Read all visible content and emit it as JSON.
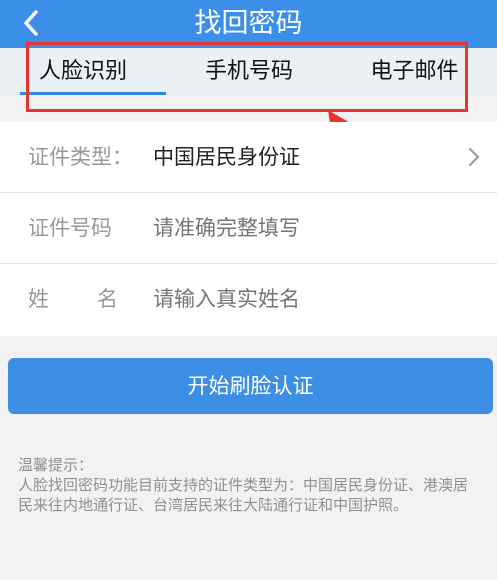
{
  "header": {
    "title": "找回密码",
    "back_icon": "chevron-left-icon",
    "back_glyph": "<",
    "background": "#3c8fe8"
  },
  "tabs": [
    {
      "label": "人脸识别",
      "selected": true
    },
    {
      "label": "手机号码",
      "selected": false
    },
    {
      "label": "电子邮件",
      "selected": false
    }
  ],
  "form": {
    "rows": [
      {
        "label": "证件类型：",
        "value": "中国居民身份证",
        "has_chevron": true
      },
      {
        "label": "证件号码",
        "placeholder": "请准确完整填写"
      },
      {
        "label_chars": [
          "姓",
          "名"
        ],
        "placeholder": "请输入真实姓名"
      }
    ]
  },
  "primary_button": {
    "label": "开始刷脸认证",
    "color": "#3d8fe6"
  },
  "tips": {
    "title": "温馨提示：",
    "body": "人脸找回密码功能目前支持的证件类型为：中国居民身份证、港澳居民来往内地通行证、台湾居民来往大陆通行证和中国护照。"
  },
  "annotation": {
    "highlight_color": "#e8342e"
  }
}
